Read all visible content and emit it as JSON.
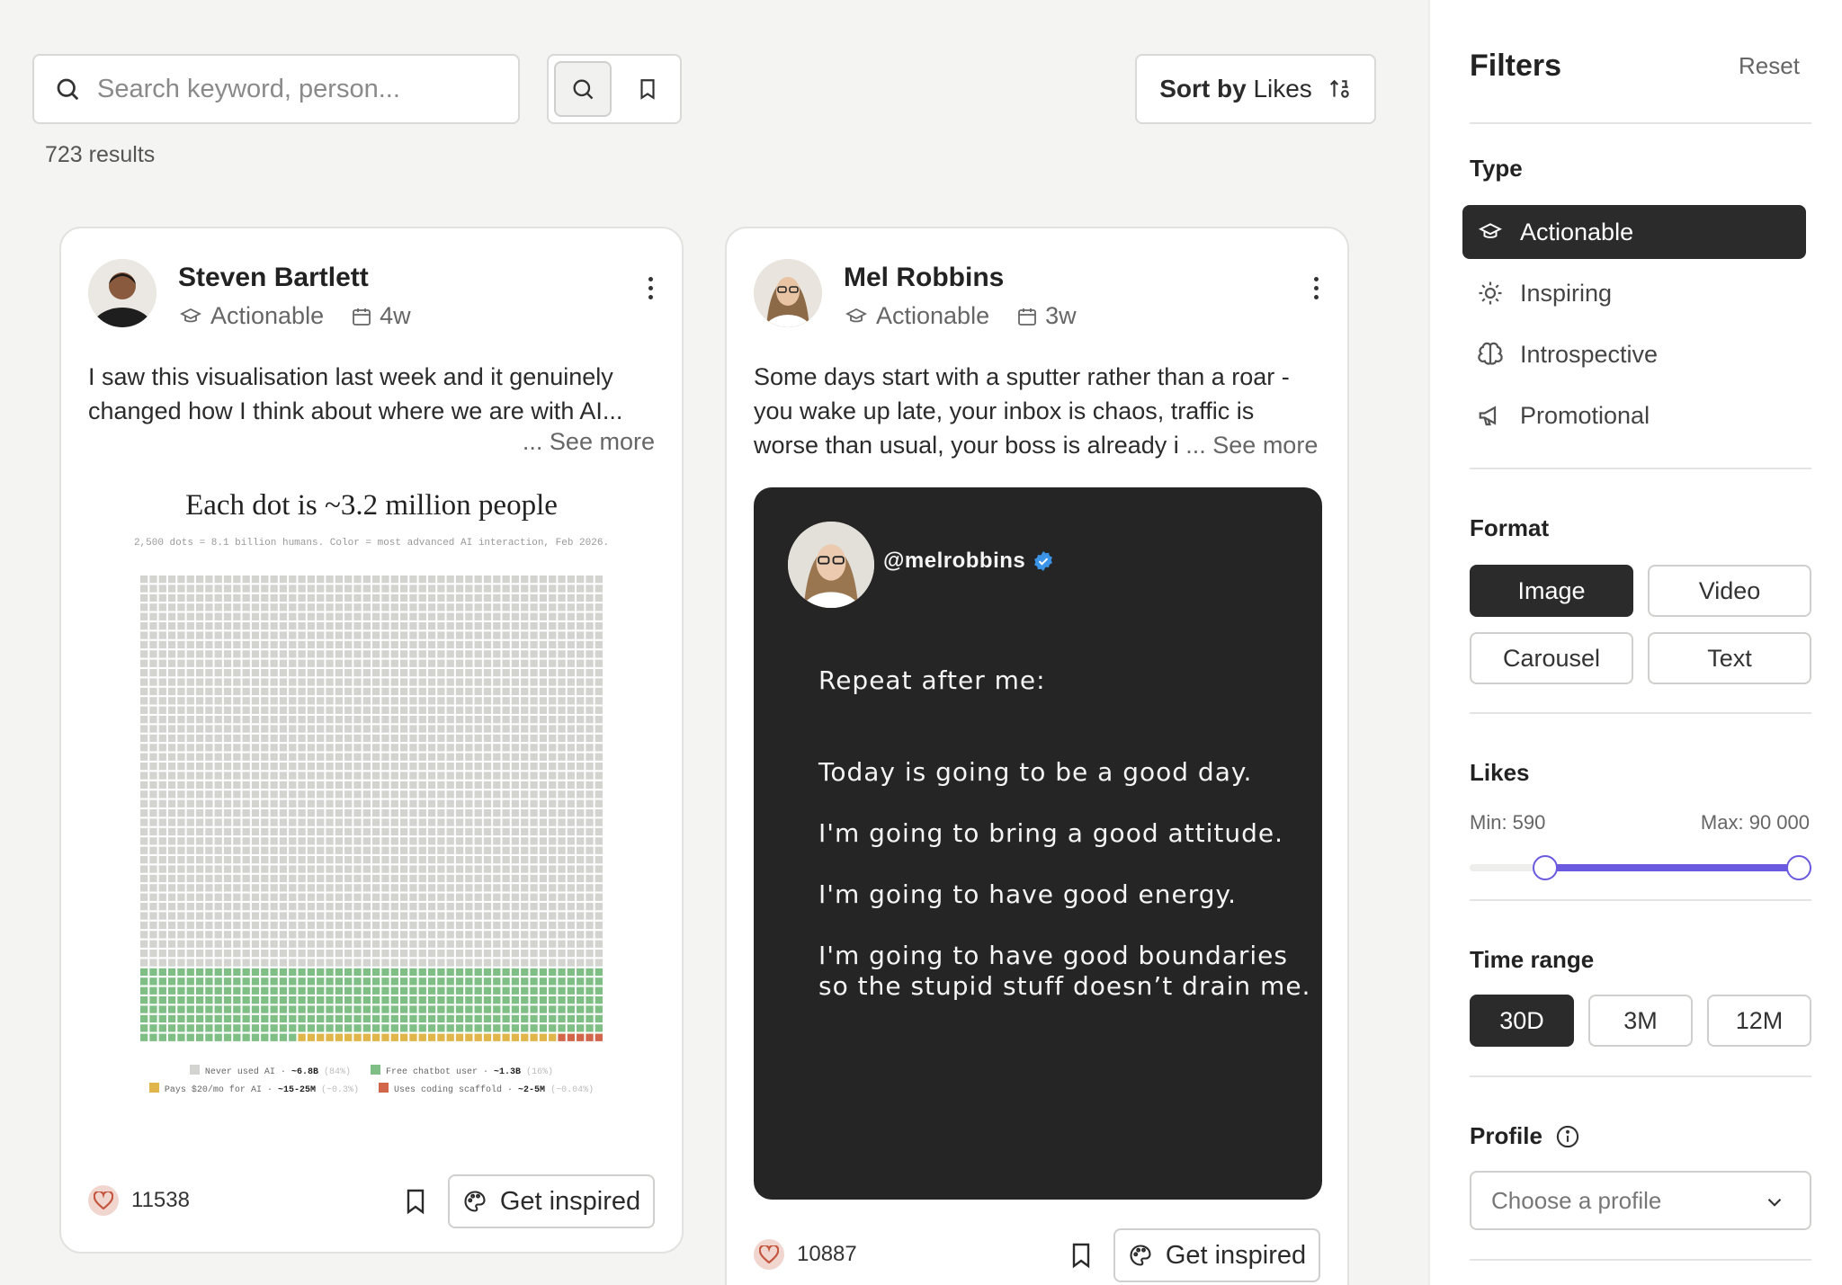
{
  "search": {
    "placeholder": "Search keyword, person..."
  },
  "sort": {
    "prefix": "Sort by",
    "value": "Likes"
  },
  "results": {
    "count_text": "723 results"
  },
  "cards": [
    {
      "author": "Steven Bartlett",
      "type": "Actionable",
      "age": "4w",
      "text": "I saw this visualisation last week and it genuinely changed how I think about where we are with AI...",
      "see_more": "... See more",
      "likes": "11538",
      "inspire_label": "Get inspired",
      "chart": {
        "title": "Each dot is ~3.2 million people",
        "subtitle": "2,500 dots = 8.1 billion humans. Color = most advanced AI interaction, Feb 2026.",
        "legend": [
          {
            "label": "Never used AI · ",
            "value": "~6.8B",
            "pct": "(84%)",
            "color": "#d3d3d0"
          },
          {
            "label": "Free chatbot user · ",
            "value": "~1.3B",
            "pct": "(16%)",
            "color": "#7fbf86"
          },
          {
            "label": "Pays $20/mo for AI · ",
            "value": "~15-25M",
            "pct": "(~0.3%)",
            "color": "#e0b54a"
          },
          {
            "label": "Uses coding scaffold · ",
            "value": "~2-5M",
            "pct": "(~0.04%)",
            "color": "#d2664a"
          }
        ]
      }
    },
    {
      "author": "Mel Robbins",
      "type": "Actionable",
      "age": "3w",
      "text": "Some days start with a sputter rather than a roar - you wake up late, your inbox is chaos, traffic is worse than usual, your boss is already i",
      "see_more": "... See more",
      "likes": "10887",
      "inspire_label": "Get inspired",
      "quote": {
        "handle": "@melrobbins",
        "lines": [
          "Repeat after me:",
          "Today is going to be a good day.",
          "I'm going to bring a good attitude.",
          "I'm going to have good energy.",
          "I'm going to have good boundaries",
          "so the stupid stuff doesn’t drain me."
        ]
      }
    }
  ],
  "filters": {
    "title": "Filters",
    "reset": "Reset",
    "type": {
      "title": "Type",
      "items": [
        {
          "label": "Actionable",
          "icon": "graduation-cap-icon",
          "active": true
        },
        {
          "label": "Inspiring",
          "icon": "sun-icon",
          "active": false
        },
        {
          "label": "Introspective",
          "icon": "brain-icon",
          "active": false
        },
        {
          "label": "Promotional",
          "icon": "megaphone-icon",
          "active": false
        }
      ]
    },
    "format": {
      "title": "Format",
      "options": [
        "Image",
        "Video",
        "Carousel",
        "Text"
      ],
      "selected": "Image"
    },
    "likes": {
      "title": "Likes",
      "min_label": "Min: 590",
      "max_label": "Max: 90 000",
      "min_fraction": 0.22,
      "max_fraction": 1.0
    },
    "time_range": {
      "title": "Time range",
      "options": [
        "30D",
        "3M",
        "12M"
      ],
      "selected": "30D"
    },
    "profile": {
      "title": "Profile",
      "placeholder": "Choose a profile"
    }
  },
  "colors": {
    "accent": "#6a5ae0",
    "dark": "#2b2b2b",
    "heart": "#c4553e"
  }
}
